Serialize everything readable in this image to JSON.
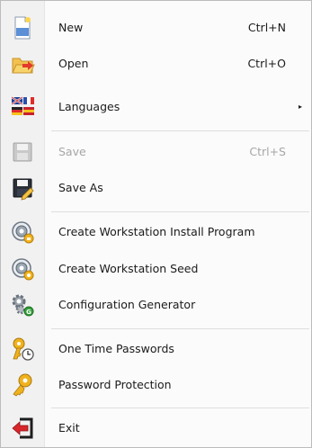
{
  "menu": {
    "new": {
      "label": "New",
      "shortcut": "Ctrl+N",
      "icon": "new-document-icon"
    },
    "open": {
      "label": "Open",
      "shortcut": "Ctrl+O",
      "icon": "open-folder-icon"
    },
    "languages": {
      "label": "Languages",
      "icon": "language-flags-icon",
      "submenu_arrow": "▸"
    },
    "save": {
      "label": "Save",
      "shortcut": "Ctrl+S",
      "icon": "save-disk-icon",
      "disabled": true
    },
    "save_as": {
      "label": "Save As",
      "icon": "save-as-icon"
    },
    "create_install": {
      "label": "Create Workstation Install Program",
      "icon": "workstation-install-icon"
    },
    "create_seed": {
      "label": "Create Workstation Seed",
      "icon": "workstation-seed-icon"
    },
    "config_generator": {
      "label": "Configuration Generator",
      "icon": "config-gears-icon"
    },
    "otp": {
      "label": "One Time Passwords",
      "icon": "key-clock-icon"
    },
    "password_protection": {
      "label": "Password Protection",
      "icon": "key-icon"
    },
    "exit": {
      "label": "Exit",
      "icon": "exit-icon"
    }
  },
  "colors": {
    "gutter": "#f1f1f1",
    "separator": "#dedede",
    "disabled_text": "#a6a6a6",
    "key_gold": "#f0b21c",
    "exit_red": "#d8262a"
  }
}
